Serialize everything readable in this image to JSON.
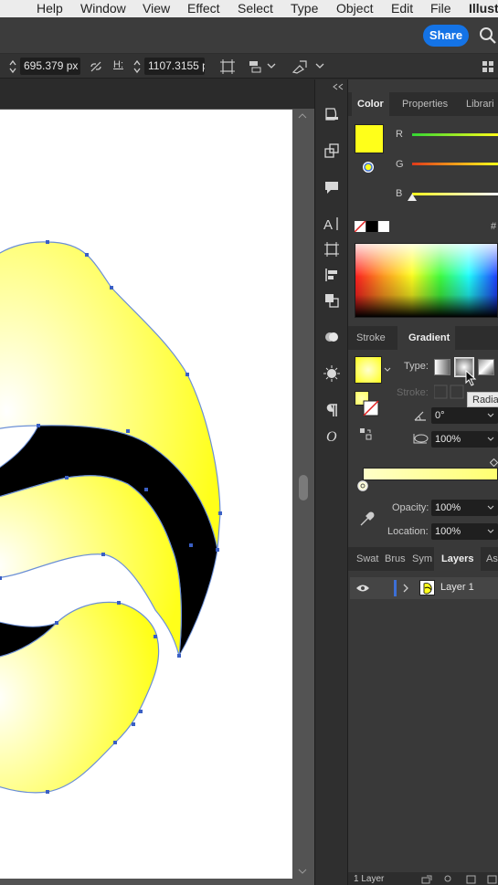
{
  "menubar": {
    "items": [
      "Help",
      "Window",
      "View",
      "Effect",
      "Select",
      "Type",
      "Object",
      "Edit",
      "File"
    ],
    "app_name": "Illust"
  },
  "appbar": {
    "share_label": "Share",
    "search_icon": "search-icon",
    "accent_color": "#1473e6"
  },
  "control_bar": {
    "width_value": "695.379 px",
    "height_label": "H:",
    "height_value": "1107.3155 p"
  },
  "artwork": {
    "fill_gradient": [
      "#ffffff",
      "#ffff1a"
    ],
    "stroke_color": "#6b8fd6",
    "anchor_color": "#3a5fc4"
  },
  "color_panel": {
    "tabs": [
      "Color",
      "Properties",
      "Librari"
    ],
    "active_tab": "Color",
    "channels": [
      "R",
      "G",
      "B"
    ],
    "hex_label": "#",
    "fill_color": "#ffff1a"
  },
  "gradient_panel": {
    "tabs": [
      "Stroke",
      "Gradient"
    ],
    "active_tab": "Gradient",
    "type_label": "Type:",
    "stroke_label": "Stroke:",
    "angle_value": "0°",
    "aspect_value": "100%",
    "opacity_label": "Opacity:",
    "opacity_value": "100%",
    "location_label": "Location:",
    "location_value": "100%",
    "tooltip": "Radia"
  },
  "layers_panel": {
    "tabs": [
      "Swat",
      "Brus",
      "Sym",
      "Layers",
      "As"
    ],
    "active_tab": "Layers",
    "layer_name": "Layer 1",
    "footer_text": "1 Layer"
  }
}
